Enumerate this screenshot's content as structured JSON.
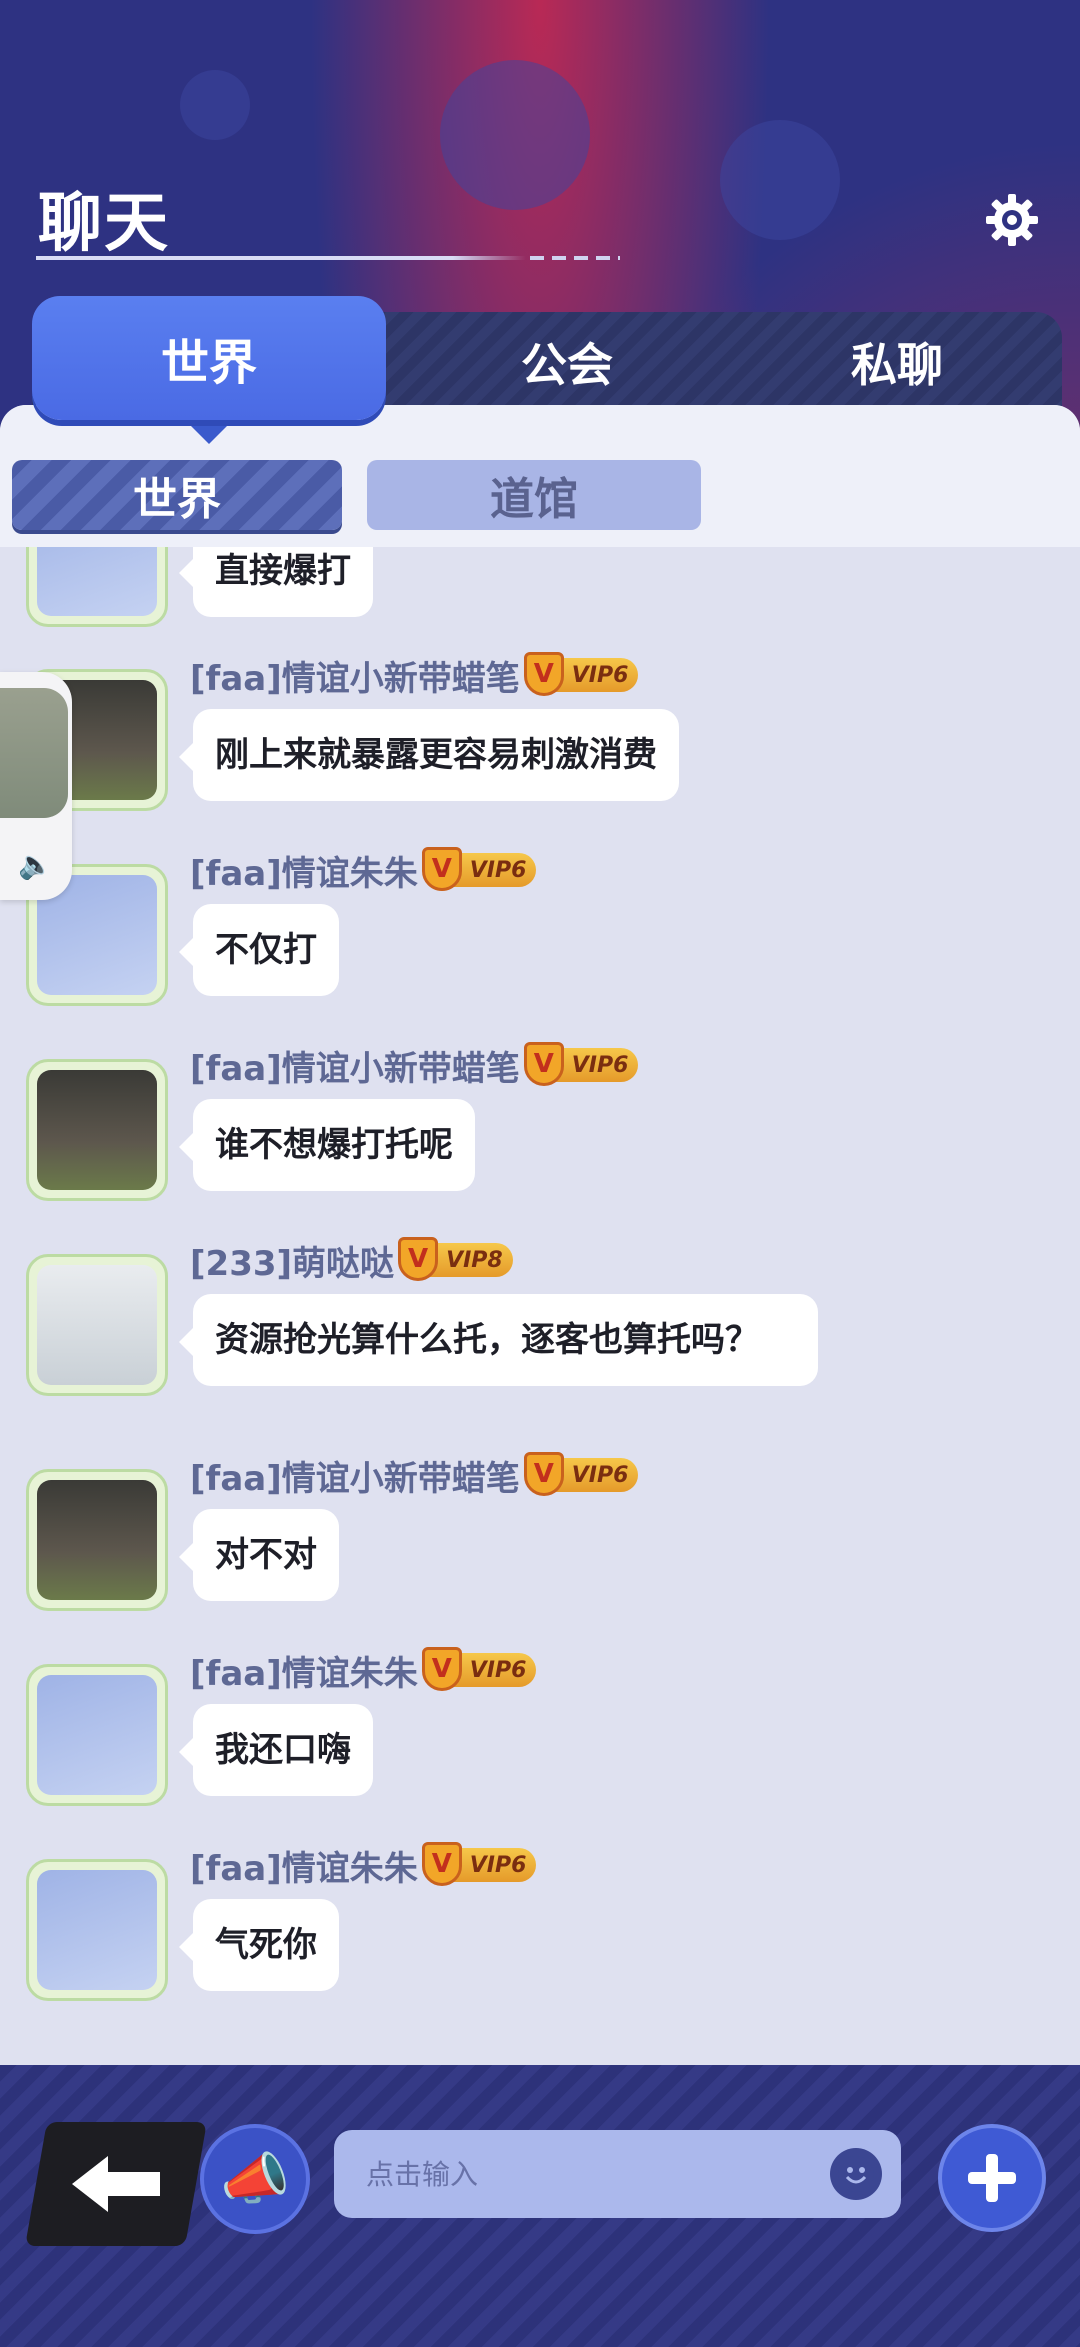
{
  "header": {
    "title": "聊天",
    "settings_icon": "gear-icon"
  },
  "main_tabs": [
    {
      "label": "世界",
      "active": true
    },
    {
      "label": "公会",
      "active": false
    },
    {
      "label": "私聊",
      "active": false
    }
  ],
  "sub_tabs": [
    {
      "label": "世界",
      "active": true
    },
    {
      "label": "道馆",
      "active": false
    }
  ],
  "messages": [
    {
      "user": "",
      "vip": "",
      "text": "直接爆打",
      "avatar": "pink-kirby"
    },
    {
      "user": "[faa]情谊小新带蜡笔",
      "vip": "VIP6",
      "text": "刚上来就暴露更容易刺激消费",
      "avatar": "plush-pig"
    },
    {
      "user": "[faa]情谊朱朱",
      "vip": "VIP6",
      "text": "不仅打",
      "avatar": "pink-kirby"
    },
    {
      "user": "[faa]情谊小新带蜡笔",
      "vip": "VIP6",
      "text": "谁不想爆打托呢",
      "avatar": "plush-pig"
    },
    {
      "user": "[233]萌哒哒",
      "vip": "VIP8",
      "text": "资源抢光算什么托，逐客也算托吗？",
      "avatar": "boat"
    },
    {
      "user": "[faa]情谊小新带蜡笔",
      "vip": "VIP6",
      "text": "对不对",
      "avatar": "plush-pig"
    },
    {
      "user": "[faa]情谊朱朱",
      "vip": "VIP6",
      "text": "我还口嗨",
      "avatar": "pink-kirby"
    },
    {
      "user": "[faa]情谊朱朱",
      "vip": "VIP6",
      "text": "气死你",
      "avatar": "pink-kirby"
    }
  ],
  "input": {
    "placeholder": "点击输入"
  },
  "colors": {
    "accent": "#4a6ae4",
    "panel": "#dfe1f0",
    "vip": "#f2a628"
  }
}
